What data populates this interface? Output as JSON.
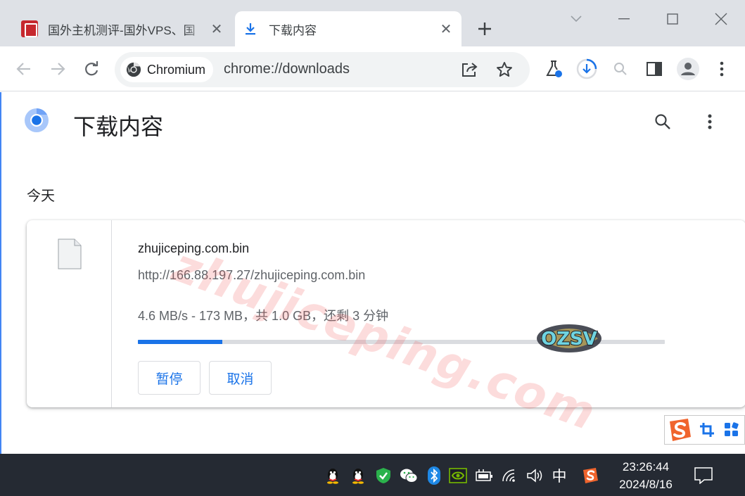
{
  "tabs": [
    {
      "title": "国外主机测评-国外VPS、国",
      "icon": "site-favicon"
    },
    {
      "title": "下载内容",
      "icon": "download-icon"
    }
  ],
  "toolbar": {
    "chip_label": "Chromium",
    "url": "chrome://downloads"
  },
  "page": {
    "title": "下载内容",
    "section_date": "今天"
  },
  "download": {
    "file_name": "zhujiceping.com.bin",
    "url": "http://166.88.197.27/zhujiceping.com.bin",
    "status": "4.6 MB/s - 173 MB，共 1.0 GB，还剩 3 分钟",
    "progress_fraction": 0.16,
    "pause_label": "暂停",
    "cancel_label": "取消"
  },
  "watermark": {
    "text": "zhujiceping.com",
    "badge_text": "OZSV"
  },
  "taskbar": {
    "ime_mode": "中",
    "time": "23:26:44",
    "date": "2024/8/16"
  },
  "colors": {
    "accent": "#1a73e8",
    "tabstrip": "#dee1e6",
    "taskbar": "#252a33",
    "sogou": "#f0642d"
  }
}
